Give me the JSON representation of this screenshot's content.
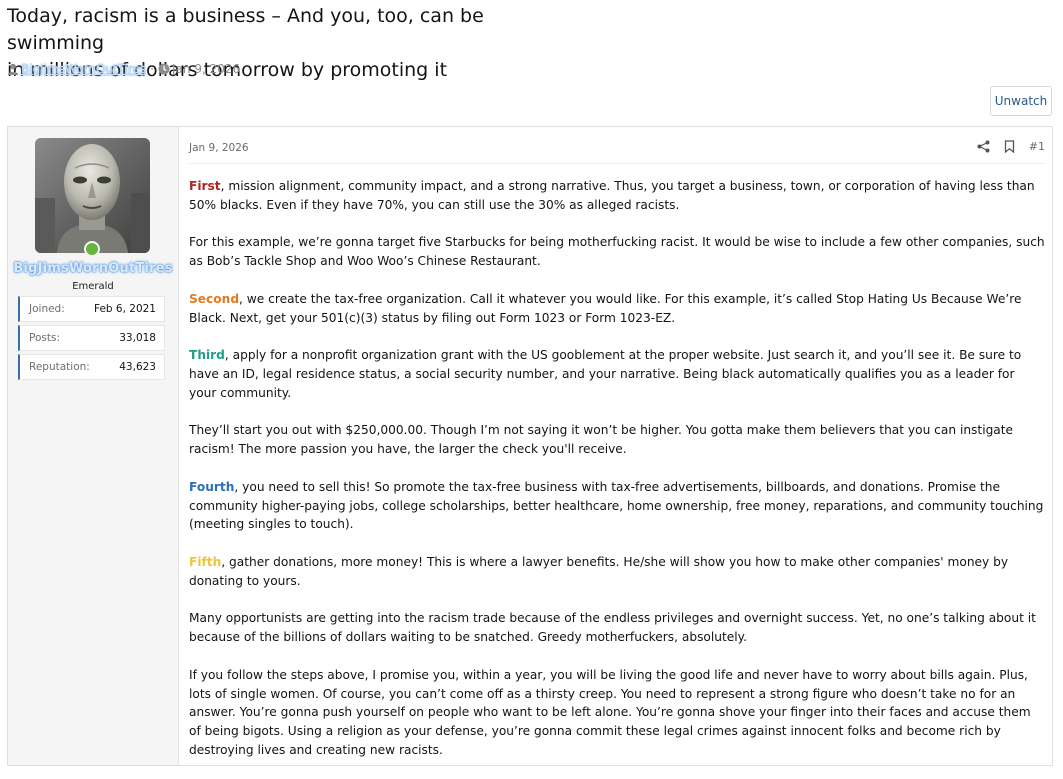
{
  "thread": {
    "title_line1": "Today, racism is a business – And you, too, can be swimming",
    "title_line2": "in millions of dollars tomorrow by promoting it",
    "author": "BigJimsWornOutTires",
    "date": "Jan 9, 2026",
    "unwatch_label": "Unwatch"
  },
  "user": {
    "name": "BigJimsWornOutTires",
    "title": "Emerald",
    "stats": [
      {
        "label": "Joined:",
        "value": "Feb 6, 2021"
      },
      {
        "label": "Posts:",
        "value": "33,018"
      },
      {
        "label": "Reputation:",
        "value": "43,623"
      }
    ],
    "online": true,
    "name_color": "#3f86d4"
  },
  "post": {
    "date": "Jan 9, 2026",
    "number": "#1",
    "icons": {
      "share": "share-icon",
      "bookmark": "bookmark-icon"
    },
    "paragraphs": [
      {
        "keyword": "First",
        "keyword_color": "#b22222",
        "text": ", mission alignment, community impact, and a strong narrative. Thus, you target a business, town, or corporation of having less than 50% blacks. Even if they have 70%, you can still use the 30% as alleged racists."
      },
      {
        "keyword": "",
        "keyword_color": "",
        "text": "For this example, we’re gonna target five Starbucks for being motherfucking racist. It would be wise to include a few other companies, such as Bob’s Tackle Shop and Woo Woo’s Chinese Restaurant."
      },
      {
        "keyword": "Second",
        "keyword_color": "#e07b1f",
        "text": ", we create the tax-free organization. Call it whatever you would like. For this example, it’s called Stop Hating Us Because We’re Black. Next, get your 501(c)(3) status by filing out Form 1023 or Form 1023-EZ."
      },
      {
        "keyword": "Third",
        "keyword_color": "#1f9e8a",
        "text": ", apply for a nonprofit organization grant with the US gooblement at the proper website. Just search it, and you’ll see it. Be sure to have an ID, legal residence status, a social security number, and your narrative. Being black automatically qualifies you as a leader for your community."
      },
      {
        "keyword": "",
        "keyword_color": "",
        "text": "They’ll start you out with $250,000.00. Though I’m not saying it won’t be higher. You gotta make them believers that you can instigate racism! The more passion you have, the larger the check you'll receive."
      },
      {
        "keyword": "Fourth",
        "keyword_color": "#2d6fb8",
        "text": ", you need to sell this! So promote the tax-free business with tax-free advertisements, billboards, and donations. Promise the community higher-paying jobs, college scholarships, better healthcare, home ownership, free money, reparations, and community touching (meeting singles to touch)."
      },
      {
        "keyword": "Fifth",
        "keyword_color": "#f0c43a",
        "text": ", gather donations, more money! This is where a lawyer benefits. He/she will show you how to make other companies' money by donating to yours."
      },
      {
        "keyword": "",
        "keyword_color": "",
        "text": "Many opportunists are getting into the racism trade because of the endless privileges and overnight success. Yet, no one’s talking about it because of the billions of dollars waiting to be snatched. Greedy motherfuckers, absolutely."
      },
      {
        "keyword": "",
        "keyword_color": "",
        "text": "If you follow the steps above, I promise you, within a year, you will be living the good life and never have to worry about bills again. Plus, lots of single women. Of course, you can’t come off as a thirsty creep. You need to represent a strong figure who doesn’t take no for an answer. You’re gonna push yourself on people who want to be left alone. You’re gonna shove your finger into their faces and accuse them of being bigots. Using a religion as your defense, you’re gonna commit these legal crimes against innocent folks and become rich by destroying lives and creating new racists."
      }
    ]
  }
}
